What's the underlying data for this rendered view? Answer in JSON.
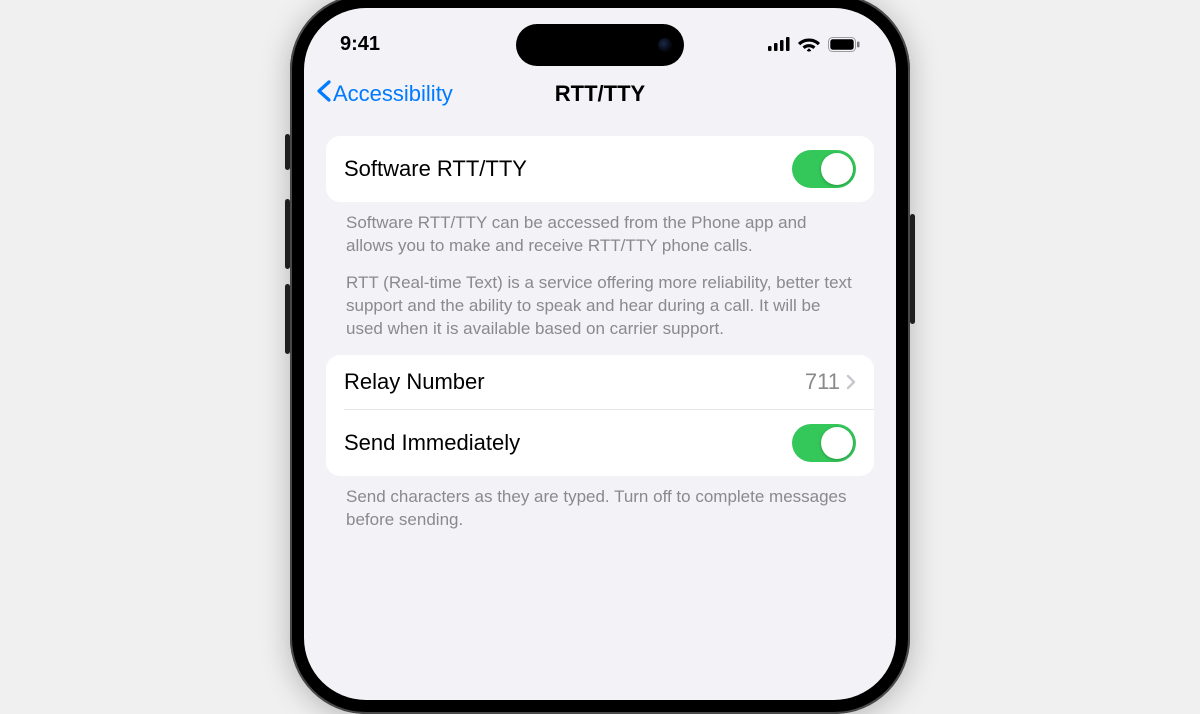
{
  "status": {
    "time": "9:41"
  },
  "nav": {
    "back_label": "Accessibility",
    "title": "RTT/TTY"
  },
  "section1": {
    "row_label": "Software RTT/TTY",
    "toggle_on": true,
    "footer_p1": "Software RTT/TTY can be accessed from the Phone app and allows you to make and receive RTT/TTY phone calls.",
    "footer_p2": "RTT (Real-time Text) is a service offering more reliability, better text support and the ability to speak and hear during a call. It will be used when it is available based on carrier support."
  },
  "section2": {
    "row1_label": "Relay Number",
    "row1_value": "711",
    "row2_label": "Send Immediately",
    "row2_toggle_on": true,
    "footer": "Send characters as they are typed. Turn off to complete messages before sending."
  }
}
